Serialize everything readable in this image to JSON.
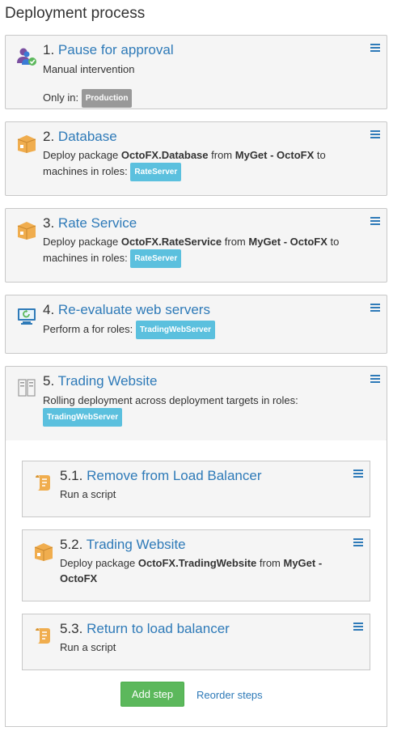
{
  "page": {
    "title": "Deployment process"
  },
  "steps": [
    {
      "number": "1.",
      "name": "Pause for approval",
      "description": "Manual intervention",
      "only_in_prefix": "Only in:",
      "environment": "Production"
    },
    {
      "number": "2.",
      "name": "Database",
      "desc_prefix": "Deploy package",
      "package": "OctoFX.Database",
      "desc_from": "from",
      "feed": "MyGet - OctoFX",
      "desc_to": "to",
      "roles_prefix": "machines in roles:",
      "role": "RateServer"
    },
    {
      "number": "3.",
      "name": "Rate Service",
      "desc_prefix": "Deploy package",
      "package": "OctoFX.RateService",
      "desc_from": "from",
      "feed": "MyGet - OctoFX",
      "desc_to": "to",
      "roles_prefix": "machines in roles:",
      "role": "RateServer"
    },
    {
      "number": "4.",
      "name": "Re-evaluate web servers",
      "description": "Perform a for roles:",
      "role": "TradingWebServer"
    },
    {
      "number": "5.",
      "name": "Trading Website",
      "description": "Rolling deployment across deployment targets in roles:",
      "role": "TradingWebServer",
      "children": [
        {
          "number": "5.1.",
          "name": "Remove from Load Balancer",
          "description": "Run a script"
        },
        {
          "number": "5.2.",
          "name": "Trading Website",
          "desc_prefix": "Deploy package",
          "package": "OctoFX.TradingWebsite",
          "desc_from": "from",
          "feed_line1": "MyGet -",
          "feed_line2": "OctoFX"
        },
        {
          "number": "5.3.",
          "name": "Return to load balancer",
          "description": "Run a script"
        }
      ]
    }
  ],
  "actions": {
    "add_step": "Add step",
    "reorder_steps": "Reorder steps"
  },
  "icons": {
    "approval": "user-approval-icon",
    "package": "package-icon",
    "health_check": "monitor-refresh-icon",
    "rolling": "server-rack-icon",
    "script": "script-icon",
    "menu": "hamburger-menu-icon"
  },
  "colors": {
    "link": "#2e7ab8",
    "add_button": "#5cb85c",
    "role_badge": "#5bc0de",
    "env_badge": "#999999",
    "package_icon": "#f0ad4e"
  }
}
